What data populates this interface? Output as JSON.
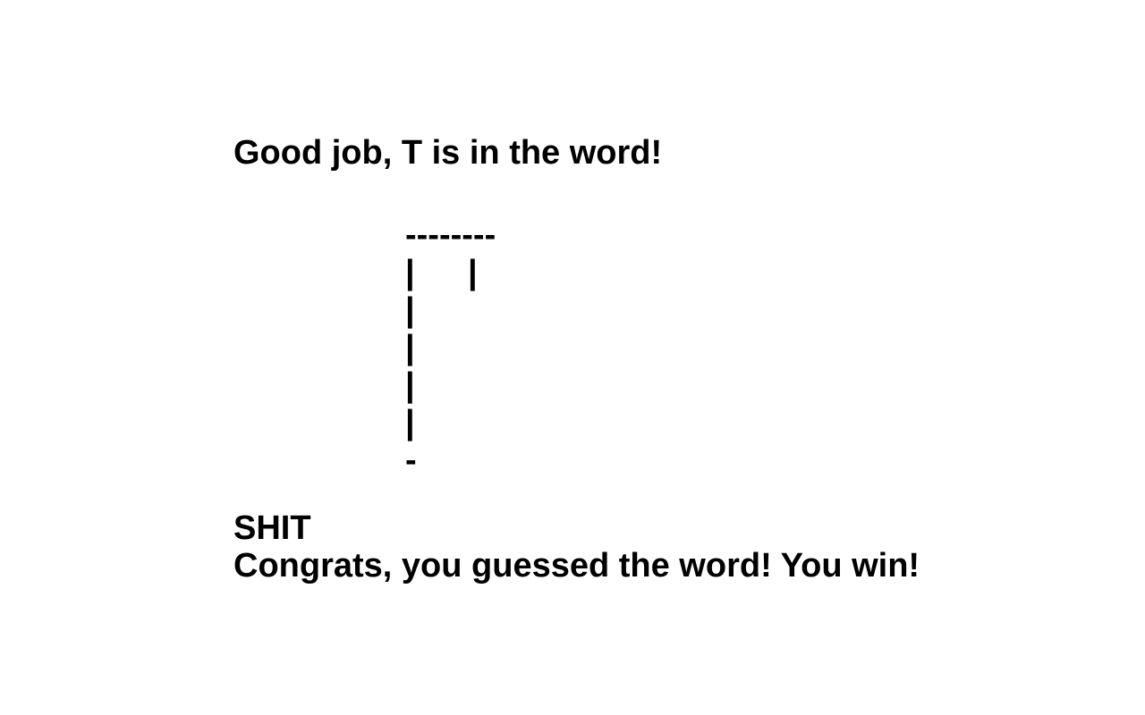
{
  "game": {
    "feedback_message": "Good job, T is in the word!",
    "gallows": {
      "top_beam": "--------",
      "rope_row_left": "|",
      "rope_row_right": "|",
      "pole_rows": [
        "|",
        "|",
        "|",
        "|"
      ],
      "base": "-"
    },
    "revealed_word": "SHIT",
    "win_message": "Congrats, you guessed the word! You win!"
  }
}
